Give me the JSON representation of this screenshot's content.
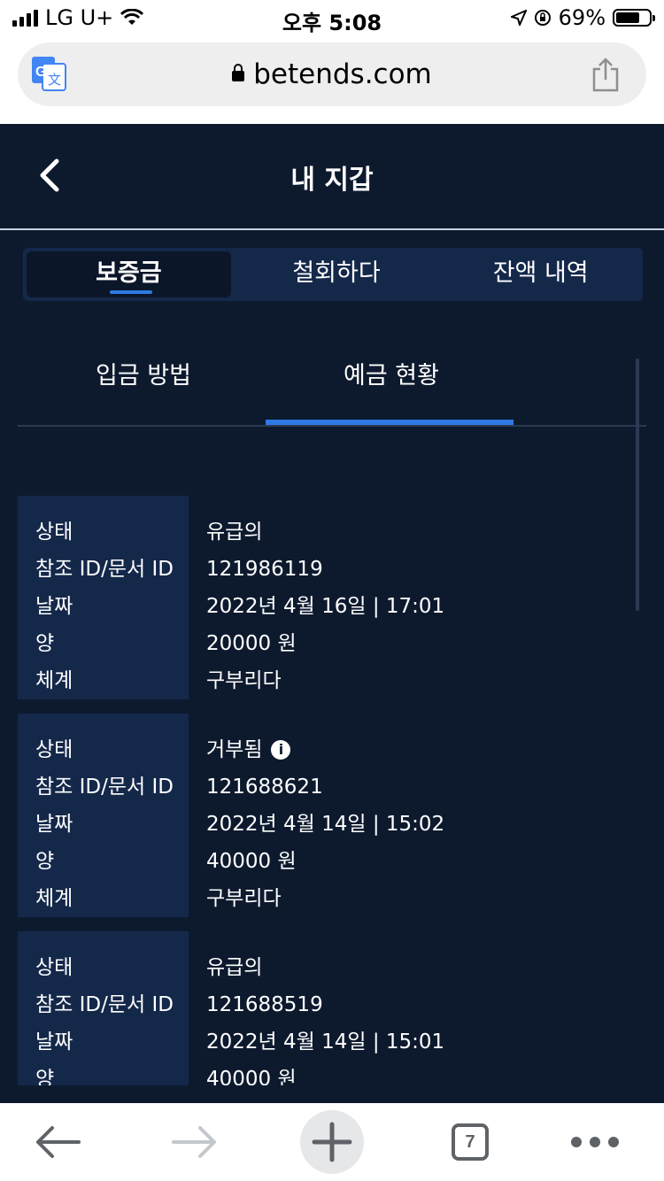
{
  "status_bar": {
    "carrier": "LG U+",
    "time": "오후 5:08",
    "battery": "69%"
  },
  "browser": {
    "url": "betends.com",
    "tab_count": "7"
  },
  "header": {
    "title": "내 지갑"
  },
  "main_tabs": [
    {
      "label": "보증금"
    },
    {
      "label": "철회하다"
    },
    {
      "label": "잔액 내역"
    }
  ],
  "sub_tabs": [
    {
      "label": "입금 방법"
    },
    {
      "label": "예금 현황"
    }
  ],
  "field_labels": {
    "status": "상태",
    "ref": "참조 ID/문서 ID",
    "date": "날짜",
    "amount": "양",
    "system": "체계"
  },
  "records": [
    {
      "status": "유급의",
      "ref": "121986119",
      "date": "2022년 4월 16일 | 17:01",
      "amount": "20000 원",
      "system": "구부리다"
    },
    {
      "status": "거부됨",
      "ref": "121688621",
      "date": "2022년 4월 14일 | 15:02",
      "amount": "40000 원",
      "system": "구부리다"
    },
    {
      "status": "유급의",
      "ref": "121688519",
      "date": "2022년 4월 14일 | 15:01",
      "amount": "40000 원",
      "system": ""
    }
  ]
}
